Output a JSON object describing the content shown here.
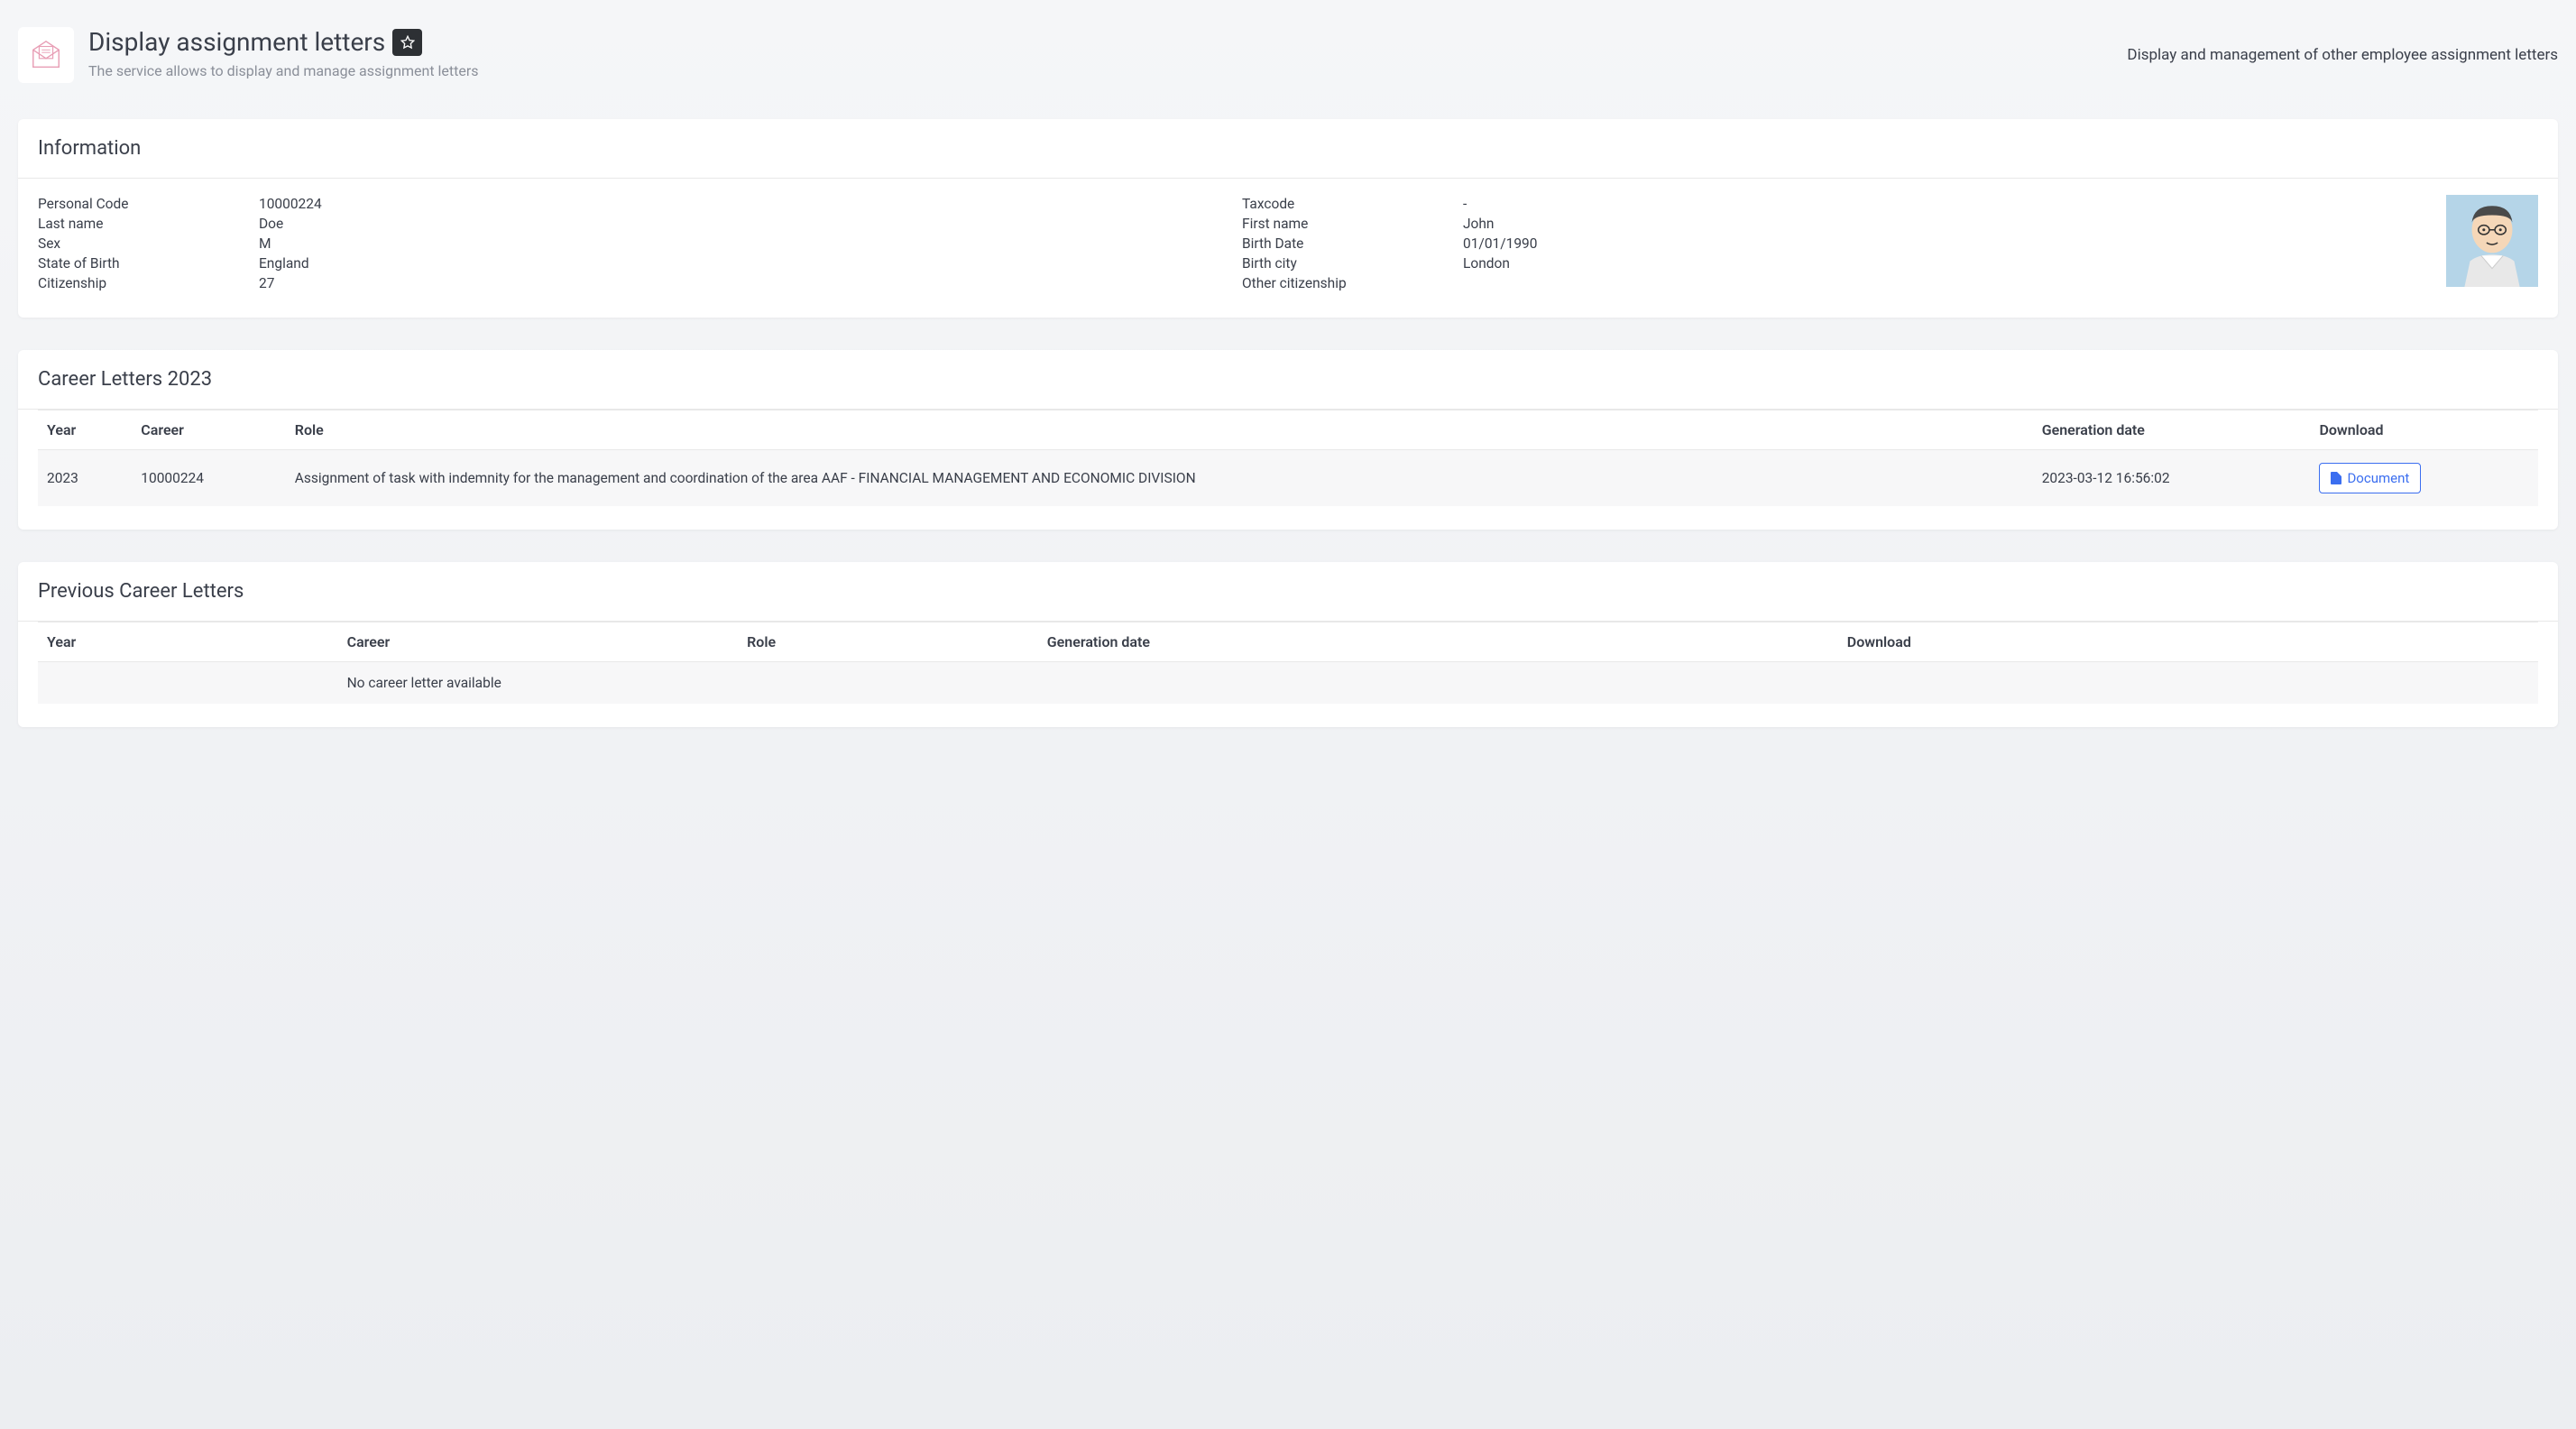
{
  "header": {
    "title": "Display assignment letters",
    "subtitle": "The service allows to display and manage assignment letters",
    "right_text": "Display and management of other employee assignment letters"
  },
  "information": {
    "title": "Information",
    "fields": {
      "personal_code": {
        "label": "Personal Code",
        "value": "10000224"
      },
      "last_name": {
        "label": "Last name",
        "value": "Doe"
      },
      "sex": {
        "label": "Sex",
        "value": "M"
      },
      "state_of_birth": {
        "label": "State of Birth",
        "value": "England"
      },
      "citizenship": {
        "label": "Citizenship",
        "value": "27"
      },
      "taxcode": {
        "label": "Taxcode",
        "value": "-"
      },
      "first_name": {
        "label": "First name",
        "value": "John"
      },
      "birth_date": {
        "label": "Birth Date",
        "value": "01/01/1990"
      },
      "birth_city": {
        "label": "Birth city",
        "value": "London"
      },
      "other_citizenship": {
        "label": "Other citizenship",
        "value": ""
      }
    }
  },
  "current_letters": {
    "title": "Career Letters 2023",
    "columns": {
      "year": "Year",
      "career": "Career",
      "role": "Role",
      "generation_date": "Generation date",
      "download": "Download"
    },
    "rows": [
      {
        "year": "2023",
        "career": "10000224",
        "role": "Assignment of task with indemnity for the management and coordination of the area AAF - FINANCIAL MANAGEMENT AND ECONOMIC DIVISION",
        "generation_date": "2023-03-12 16:56:02",
        "download_label": "Document"
      }
    ]
  },
  "previous_letters": {
    "title": "Previous Career Letters",
    "columns": {
      "year": "Year",
      "career": "Career",
      "role": "Role",
      "generation_date": "Generation date",
      "download": "Download"
    },
    "empty_message": "No career letter available"
  }
}
